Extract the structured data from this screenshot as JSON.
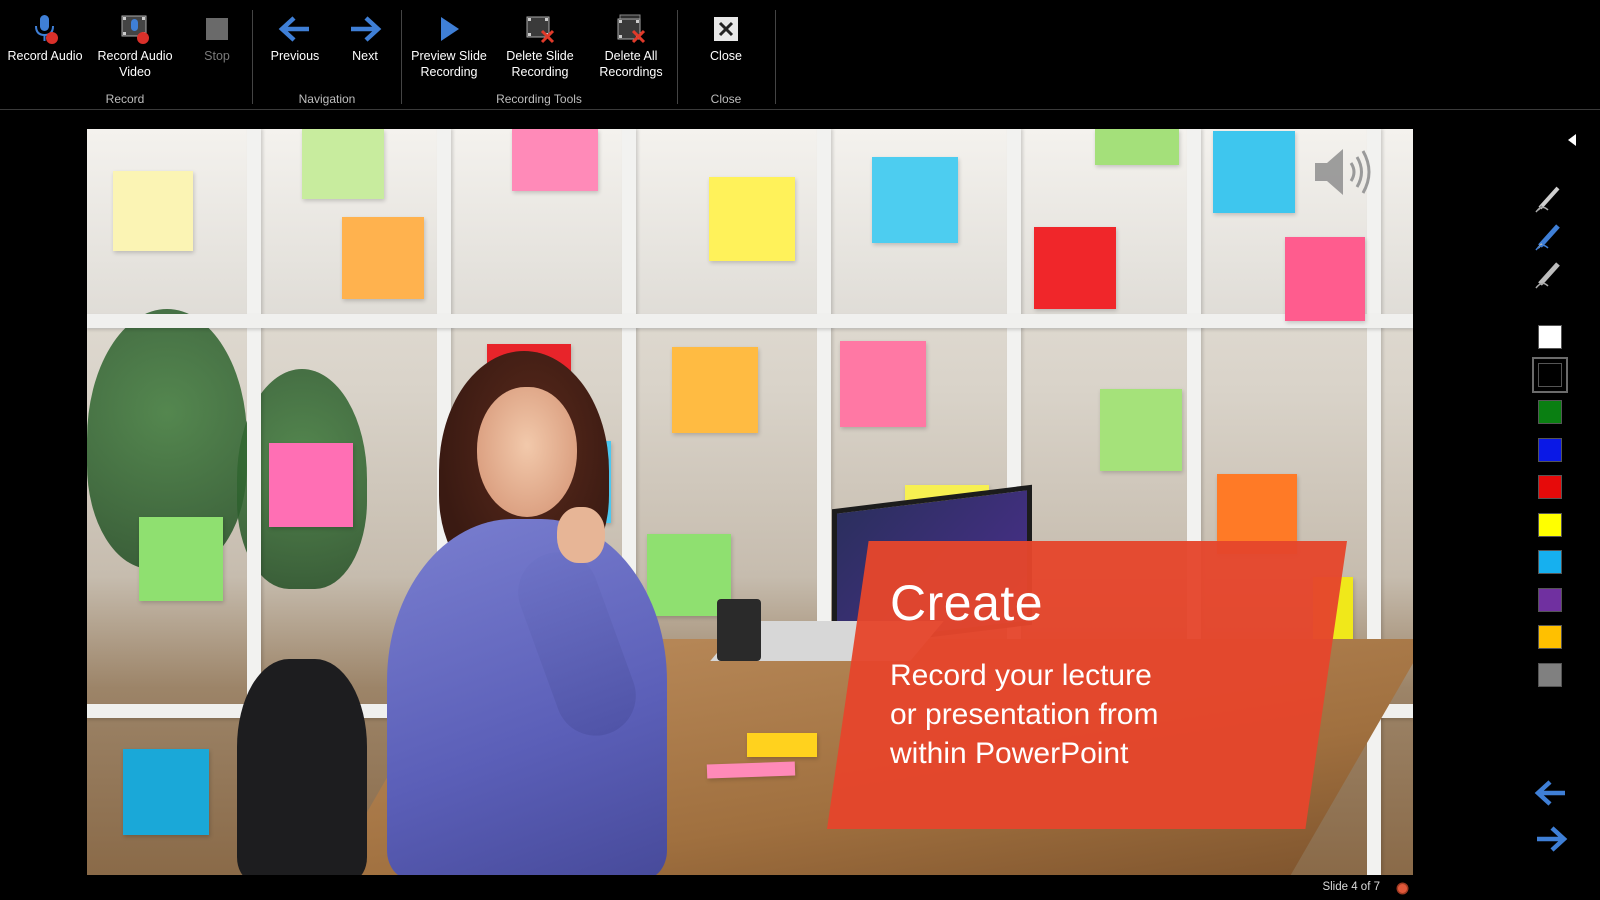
{
  "ribbon": {
    "groups": {
      "record": "Record",
      "navigation": "Navigation",
      "recording_tools": "Recording Tools",
      "close": "Close"
    },
    "buttons": {
      "record_audio": "Record Audio",
      "record_audio_video_1": "Record Audio",
      "record_audio_video_2": "Video",
      "stop": "Stop",
      "previous": "Previous",
      "next": "Next",
      "preview_1": "Preview Slide",
      "preview_2": "Recording",
      "delete_slide_1": "Delete Slide",
      "delete_slide_2": "Recording",
      "delete_all_1": "Delete All",
      "delete_all_2": "Recordings",
      "close": "Close"
    }
  },
  "slide": {
    "title": "Create",
    "body_line1": "Record your lecture",
    "body_line2": "or presentation from",
    "body_line3": "within PowerPoint",
    "accent_color": "#e5462c"
  },
  "status": {
    "slide_counter": "Slide 4 of 7"
  },
  "toolbar": {
    "pens": [
      "pen-icon",
      "highlighter-icon",
      "eraser-icon"
    ],
    "colors": [
      "#ffffff",
      "#000000",
      "#0a7f12",
      "#0a18e6",
      "#e60a0a",
      "#ffff00",
      "#16b0ef",
      "#7030a0",
      "#ffc000",
      "#808080"
    ],
    "selected_color": "#000000"
  }
}
